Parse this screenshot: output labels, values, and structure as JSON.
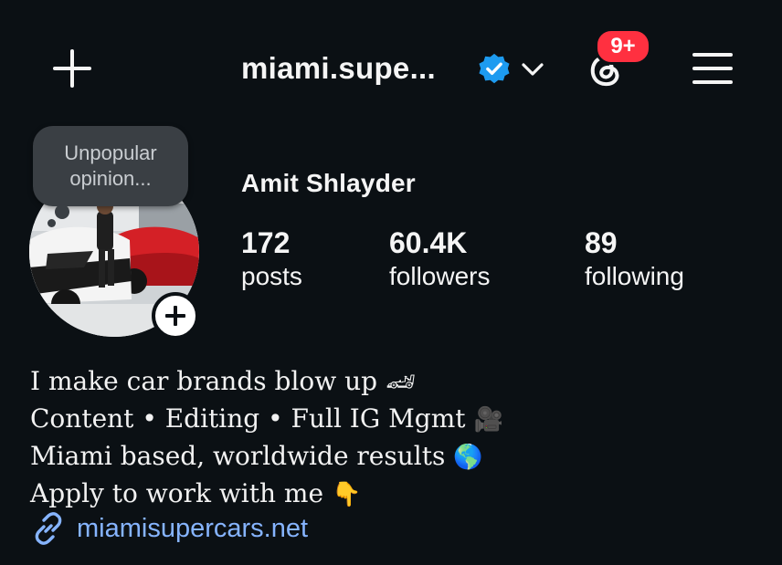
{
  "header": {
    "username": "miami.supe...",
    "notifications_badge": "9+"
  },
  "profile": {
    "note": [
      "Unpopular",
      "opinion..."
    ],
    "display_name": "Amit Shlayder",
    "stats": [
      {
        "value": "172",
        "label": "posts"
      },
      {
        "value": "60.4K",
        "label": "followers"
      },
      {
        "value": "89",
        "label": "following"
      }
    ]
  },
  "bio": {
    "lines": [
      {
        "text": "I make car brands blow up",
        "emoji": "🏎"
      },
      {
        "text": "Content • Editing • Full IG Mgmt",
        "emoji": "🎥"
      },
      {
        "text": "Miami based, worldwide results",
        "emoji": "🌎"
      },
      {
        "text": "Apply to work with me",
        "emoji": "👇"
      }
    ],
    "link": "miamisupercars.net"
  },
  "colors": {
    "background": "#0b1014",
    "verified": "#1d9bf0",
    "badge": "#ff3040",
    "link": "#86b4ff"
  },
  "icons": [
    "create-plus-icon",
    "verified-badge-icon",
    "chevron-down-icon",
    "threads-icon",
    "hamburger-menu-icon",
    "add-story-plus-icon",
    "link-icon"
  ]
}
